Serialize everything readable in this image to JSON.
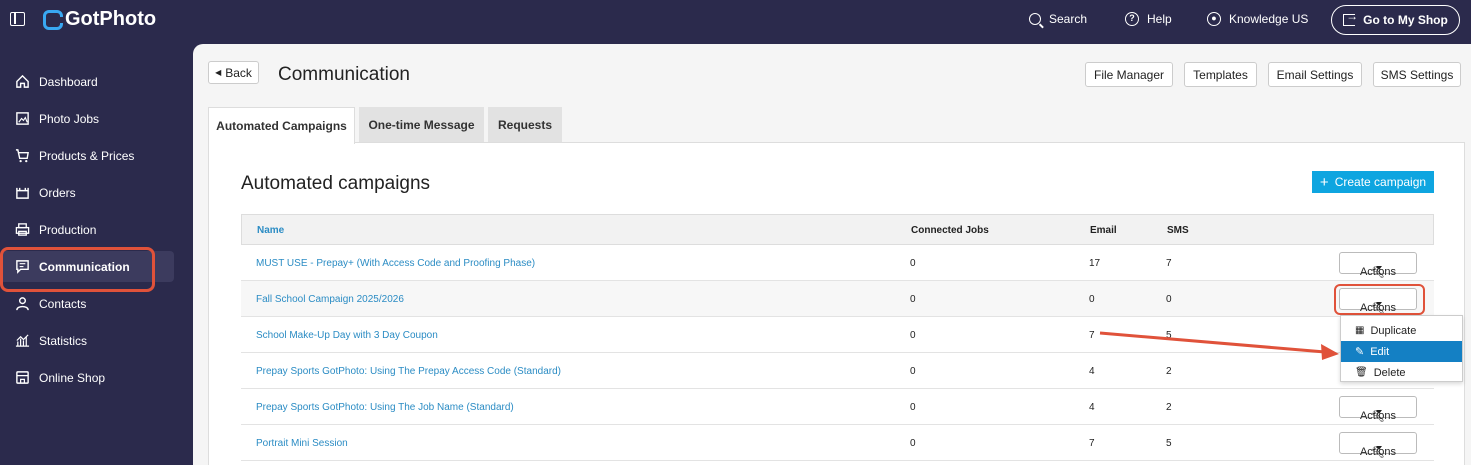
{
  "topbar": {
    "brand": "GotPhoto",
    "search_label": "Search",
    "help_label": "Help",
    "account_label": "Knowledge US",
    "shop_button": "Go to My Shop"
  },
  "sidebar": {
    "items": [
      {
        "label": "Dashboard",
        "icon": "home-icon"
      },
      {
        "label": "Photo Jobs",
        "icon": "image-icon"
      },
      {
        "label": "Products & Prices",
        "icon": "cart-icon"
      },
      {
        "label": "Orders",
        "icon": "orders-icon"
      },
      {
        "label": "Production",
        "icon": "printer-icon"
      },
      {
        "label": "Communication",
        "icon": "message-icon"
      },
      {
        "label": "Contacts",
        "icon": "person-icon"
      },
      {
        "label": "Statistics",
        "icon": "chart-icon"
      },
      {
        "label": "Online Shop",
        "icon": "shop-icon"
      }
    ]
  },
  "header": {
    "back_label": "Back",
    "title": "Communication",
    "buttons": [
      "File Manager",
      "Templates",
      "Email Settings",
      "SMS Settings"
    ]
  },
  "tabs": [
    "Automated Campaigns",
    "One-time Message",
    "Requests"
  ],
  "panel": {
    "title": "Automated campaigns",
    "create_label": "Create campaign",
    "columns": {
      "name": "Name",
      "jobs": "Connected Jobs",
      "email": "Email",
      "sms": "SMS"
    },
    "rows": [
      {
        "name": "MUST USE - Prepay+ (With Access Code and Proofing Phase)",
        "jobs": "0",
        "email": "17",
        "sms": "7",
        "actions": "Actions"
      },
      {
        "name": "Fall School Campaign 2025/2026",
        "jobs": "0",
        "email": "0",
        "sms": "0",
        "actions": "Actions"
      },
      {
        "name": "School Make-Up Day with 3 Day Coupon",
        "jobs": "0",
        "email": "7",
        "sms": "5",
        "actions": ""
      },
      {
        "name": "Prepay Sports GotPhoto: Using The Prepay Access Code (Standard)",
        "jobs": "0",
        "email": "4",
        "sms": "2",
        "actions": ""
      },
      {
        "name": "Prepay Sports GotPhoto: Using The Job Name (Standard)",
        "jobs": "0",
        "email": "4",
        "sms": "2",
        "actions": "Actions"
      },
      {
        "name": "Portrait Mini Session",
        "jobs": "0",
        "email": "7",
        "sms": "5",
        "actions": "Actions"
      }
    ]
  },
  "dropdown": {
    "items": [
      "Duplicate",
      "Edit",
      "Delete"
    ],
    "selected": "Edit"
  },
  "colors": {
    "sidebar_bg": "#2b2a4c",
    "accent": "#0ea5e0",
    "highlight": "#e0523a",
    "link": "#2b8cc4"
  }
}
